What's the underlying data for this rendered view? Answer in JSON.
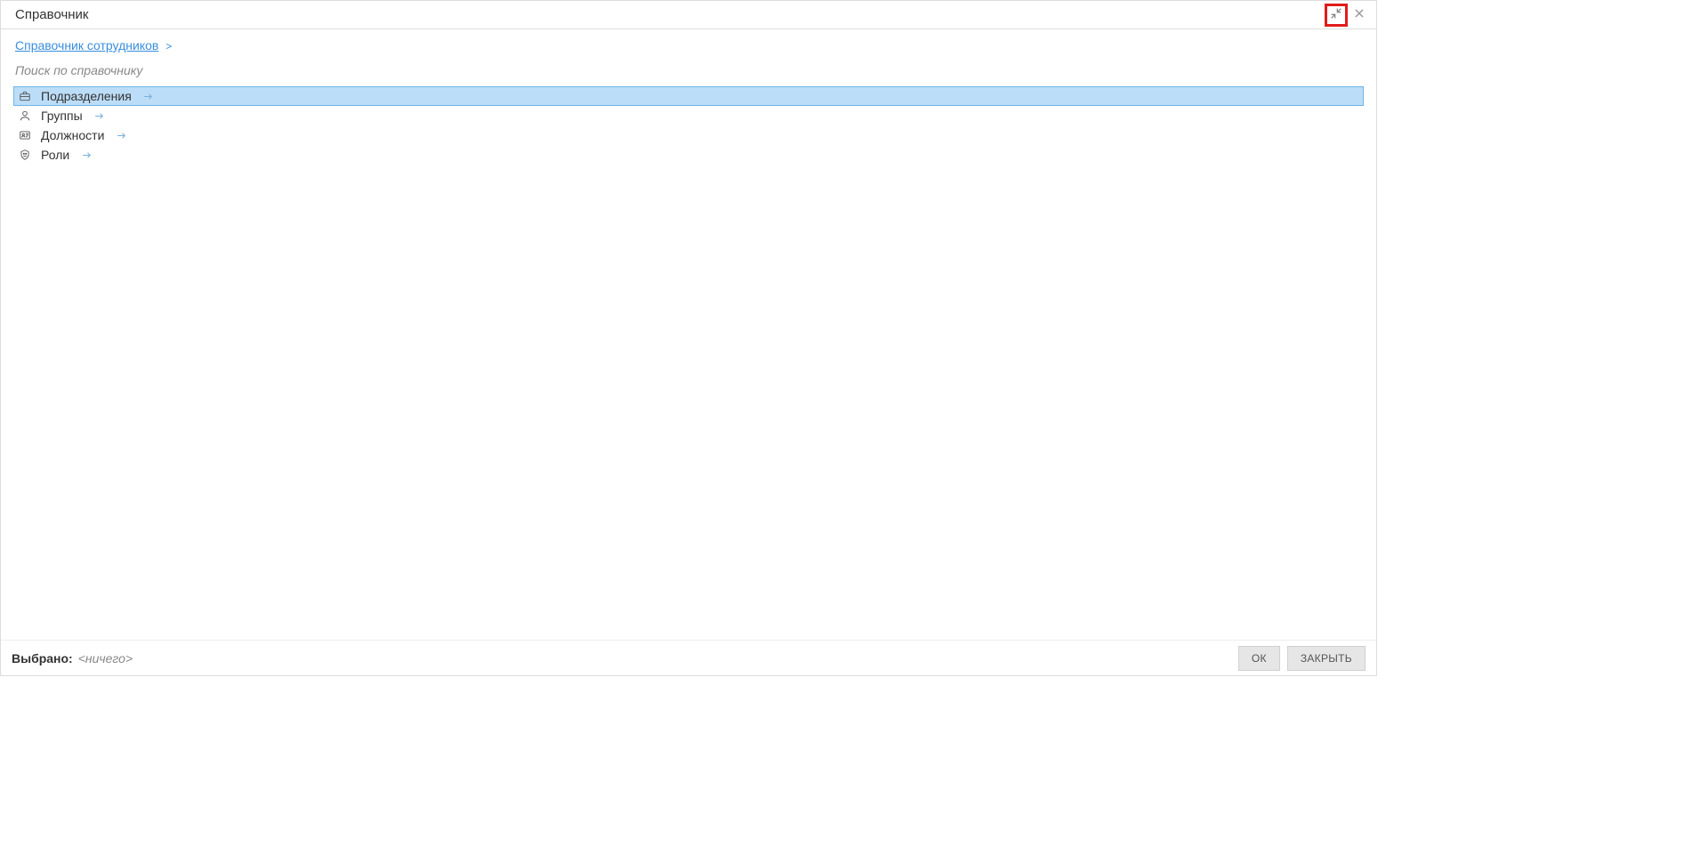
{
  "dialog": {
    "title": "Справочник"
  },
  "breadcrumb": {
    "link": "Справочник сотрудников",
    "sep": ">"
  },
  "search": {
    "placeholder": "Поиск по справочнику"
  },
  "items": [
    {
      "label": "Подразделения",
      "icon": "briefcase",
      "selected": true
    },
    {
      "label": "Группы",
      "icon": "user",
      "selected": false
    },
    {
      "label": "Должности",
      "icon": "id-card",
      "selected": false
    },
    {
      "label": "Роли",
      "icon": "shield",
      "selected": false
    }
  ],
  "footer": {
    "selected_label": "Выбрано:",
    "selected_value": "<ничего>",
    "ok": "ок",
    "close": "закрыть"
  }
}
